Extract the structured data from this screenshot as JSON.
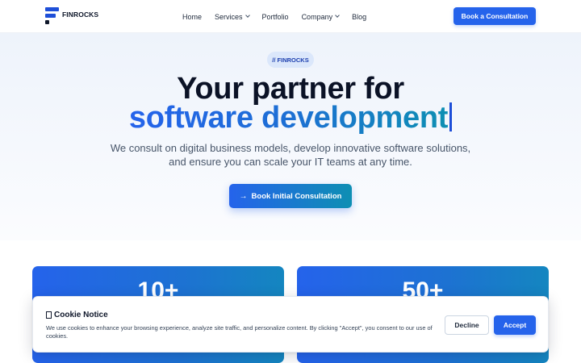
{
  "header": {
    "logo_text": "FINROCKS",
    "nav": [
      {
        "label": "Home"
      },
      {
        "label": "Services"
      },
      {
        "label": "Portfolio"
      },
      {
        "label": "Company"
      },
      {
        "label": "Blog"
      }
    ],
    "cta_label": "Book a Consultation"
  },
  "hero": {
    "badge": "// FINROCKS",
    "title_line1": "Your partner for",
    "title_line2": "software development",
    "subtitle": "We consult on digital business models, develop innovative software solutions, and ensure you can scale your IT teams at any time.",
    "cta_label": "Book Initial Consultation"
  },
  "stats": [
    {
      "value": "10+"
    },
    {
      "value": "50+"
    }
  ],
  "cookie": {
    "title": "Cookie Notice",
    "text": "We use cookies to enhance your browsing experience, analyze site traffic, and personalize content. By clicking \"Accept\", you consent to our use of cookies.",
    "decline_label": "Decline",
    "accept_label": "Accept"
  },
  "colors": {
    "accent": "#2563eb",
    "accent_teal": "#0e8fb3",
    "heading": "#0b1226"
  }
}
